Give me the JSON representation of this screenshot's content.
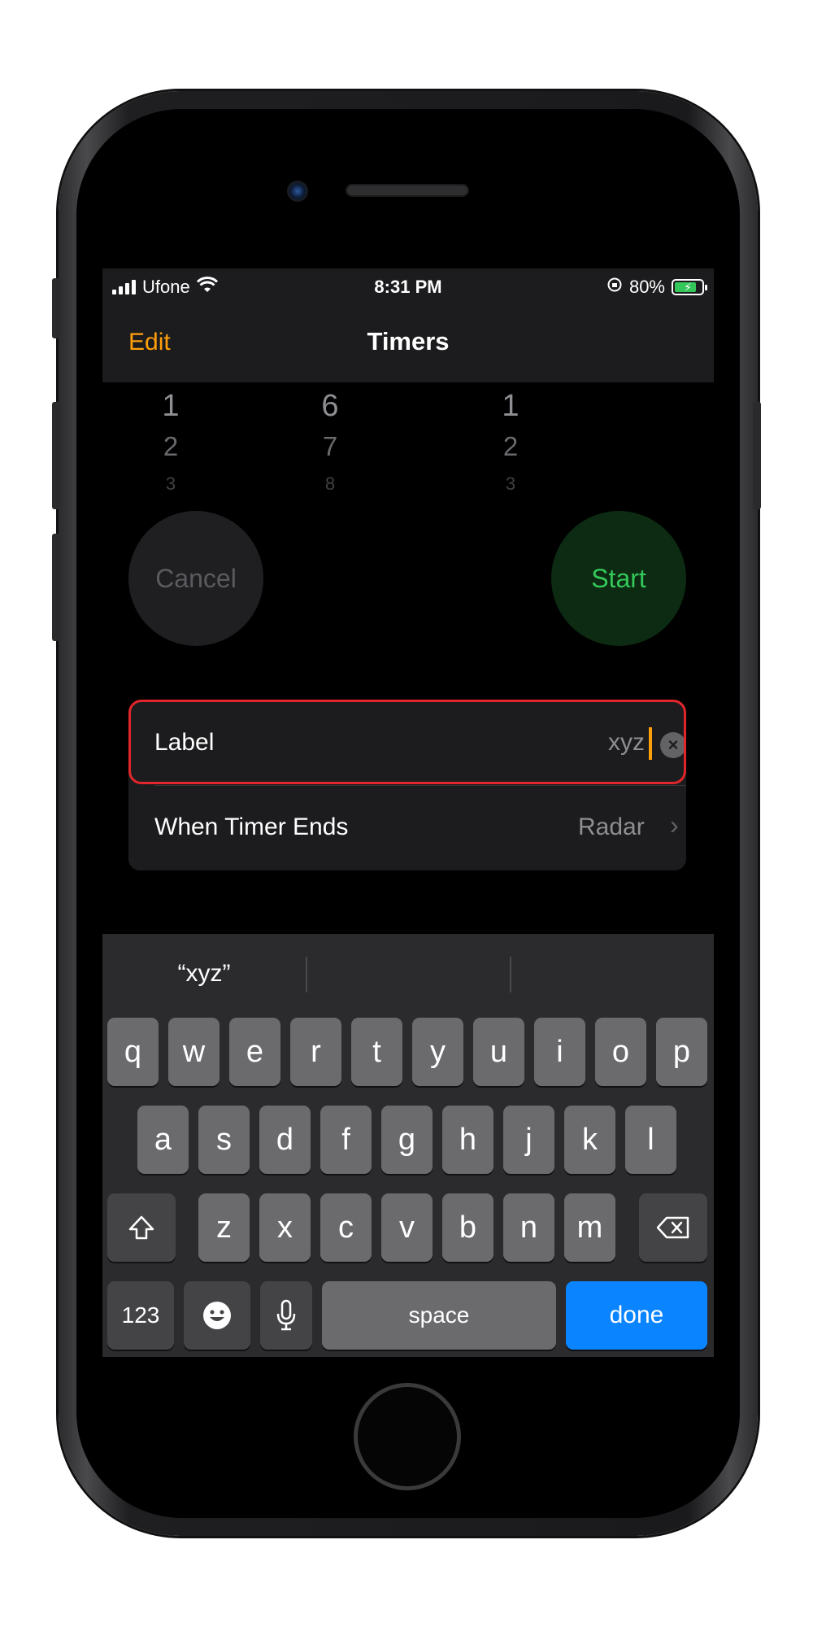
{
  "status_bar": {
    "carrier": "Ufone",
    "time": "8:31 PM",
    "battery_percent": "80%",
    "battery_level": 0.8,
    "icons": [
      "signal-icon",
      "wifi-icon",
      "orientation-lock-icon",
      "battery-charging-icon"
    ]
  },
  "nav": {
    "edit_label": "Edit",
    "title": "Timers"
  },
  "picker": {
    "hours": [
      "1",
      "2",
      "3"
    ],
    "minutes": [
      "6",
      "7",
      "8"
    ],
    "seconds": [
      "1",
      "2",
      "3"
    ]
  },
  "controls": {
    "cancel_label": "Cancel",
    "start_label": "Start"
  },
  "settings": {
    "label_row": {
      "label": "Label",
      "value": "xyz"
    },
    "timer_end_row": {
      "label": "When Timer Ends",
      "value": "Radar"
    }
  },
  "keyboard": {
    "suggestions": [
      "“xyz”",
      "",
      ""
    ],
    "row1": [
      "q",
      "w",
      "e",
      "r",
      "t",
      "y",
      "u",
      "i",
      "o",
      "p"
    ],
    "row2": [
      "a",
      "s",
      "d",
      "f",
      "g",
      "h",
      "j",
      "k",
      "l"
    ],
    "row3": [
      "z",
      "x",
      "c",
      "v",
      "b",
      "n",
      "m"
    ],
    "numbers_label": "123",
    "space_label": "space",
    "done_label": "done"
  },
  "colors": {
    "accent_orange": "#ff9f0a",
    "start_green": "#34c759",
    "done_blue": "#0a84ff",
    "highlight_red": "#e0262b"
  }
}
